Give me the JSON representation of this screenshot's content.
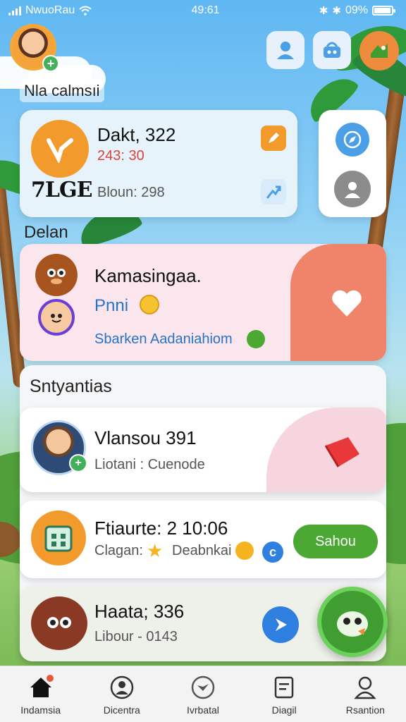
{
  "status_bar": {
    "carrier": "NwuoRau",
    "time": "49:61",
    "battery": "09%"
  },
  "header": {
    "username": "Nla calmsıi"
  },
  "stats_card": {
    "title": "Dakt, 322",
    "secondary": "243: 30",
    "logo_text": "7LGE",
    "detail": "Bloun: 298"
  },
  "section_label": "Delan",
  "activity_card": {
    "title": "Kamasingaa.",
    "subtitle": "Pnni",
    "detail": "Sbarken Aadaniahiom"
  },
  "list_heading": "Sntyantias",
  "list_items": [
    {
      "title": "Vlansou 391",
      "subtitle": "Liotani : Cuenode"
    },
    {
      "title": "Ftiaurte: 2 10:06",
      "subtitle": "Clagan:",
      "subtitle_extra": "Deabnkai",
      "action_label": "Sahou"
    },
    {
      "title": "Haata; 336",
      "subtitle": "Libour - 0143"
    }
  ],
  "bottom_nav": [
    {
      "label": "Indamsia",
      "icon": "home-icon"
    },
    {
      "label": "Dicentra",
      "icon": "user-circle-icon"
    },
    {
      "label": "Ivrbatal",
      "icon": "bird-icon"
    },
    {
      "label": "Diagil",
      "icon": "document-icon"
    },
    {
      "label": "Rsantion",
      "icon": "profile-icon"
    }
  ],
  "colors": {
    "accent_green": "#4aa833",
    "accent_orange": "#f08a3a",
    "accent_coral": "#f0846a"
  }
}
